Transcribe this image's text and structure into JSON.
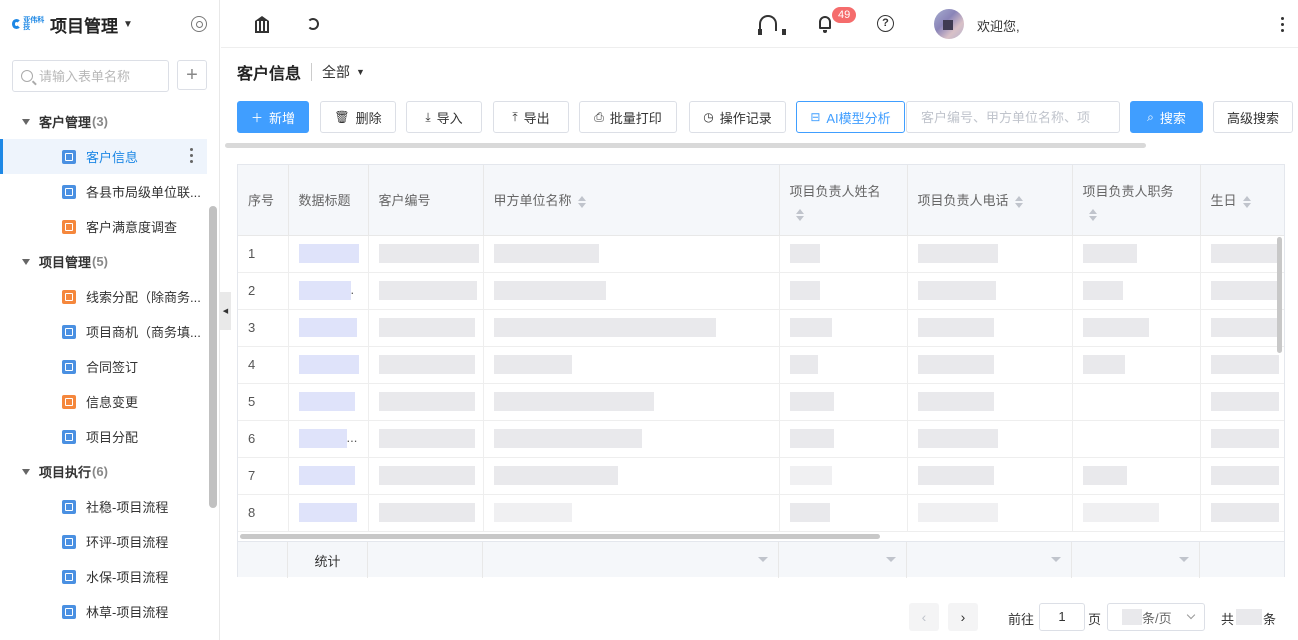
{
  "sidebar": {
    "logo_text": "亚伟科技",
    "title": "项目管理",
    "search_placeholder": "请输入表单名称",
    "add_label": "+",
    "groups": [
      {
        "label": "客户管理",
        "count": "(3)",
        "items": [
          {
            "label": "客户信息",
            "icon": "form-icon",
            "color": "#4a90e2",
            "active": true
          },
          {
            "label": "各县市局级单位联...",
            "icon": "form-icon",
            "color": "#4a90e2"
          },
          {
            "label": "客户满意度调查",
            "icon": "chart-icon",
            "color": "#f5873c"
          }
        ]
      },
      {
        "label": "项目管理",
        "count": "(5)",
        "items": [
          {
            "label": "线索分配（除商务...",
            "icon": "message-icon",
            "color": "#f5873c"
          },
          {
            "label": "项目商机（商务填...",
            "icon": "doc-icon",
            "color": "#4a90e2"
          },
          {
            "label": "合同签订",
            "icon": "doc-icon",
            "color": "#4a90e2"
          },
          {
            "label": "信息变更",
            "icon": "doc-icon",
            "color": "#f5873c"
          },
          {
            "label": "项目分配",
            "icon": "doc-icon",
            "color": "#4a90e2"
          }
        ]
      },
      {
        "label": "项目执行",
        "count": "(6)",
        "items": [
          {
            "label": "社稳-项目流程",
            "icon": "doc-icon",
            "color": "#4a90e2"
          },
          {
            "label": "环评-项目流程",
            "icon": "doc-icon",
            "color": "#4a90e2"
          },
          {
            "label": "水保-项目流程",
            "icon": "doc-icon",
            "color": "#4a90e2"
          },
          {
            "label": "林草-项目流程",
            "icon": "doc-icon",
            "color": "#4a90e2"
          }
        ]
      }
    ]
  },
  "topbar": {
    "notification_count": "49",
    "help_glyph": "?",
    "welcome": "欢迎您,"
  },
  "page": {
    "title": "客户信息",
    "filter": "全部"
  },
  "toolbar": {
    "new_label": "新增",
    "delete_label": "删除",
    "import_label": "导入",
    "export_label": "导出",
    "batch_print_label": "批量打印",
    "op_log_label": "操作记录",
    "ai_label": "AI模型分析",
    "search_placeholder": "客户编号、甲方单位名称、项",
    "search_label": "搜索",
    "advanced_label": "高级搜索"
  },
  "table": {
    "columns": {
      "seq": "序号",
      "data_title": "数据标题",
      "customer_no": "客户编号",
      "party_a": "甲方单位名称",
      "leader_name": "项目负责人姓名",
      "leader_phone": "项目负责人电话",
      "leader_title": "项目负责人职务",
      "birthday": "生日"
    },
    "rows": [
      {
        "seq": "1",
        "ellipsis": ""
      },
      {
        "seq": "2",
        "ellipsis": "."
      },
      {
        "seq": "3",
        "ellipsis": ""
      },
      {
        "seq": "4",
        "ellipsis": ""
      },
      {
        "seq": "5",
        "ellipsis": ""
      },
      {
        "seq": "6",
        "ellipsis": "..."
      },
      {
        "seq": "7",
        "ellipsis": ""
      },
      {
        "seq": "8",
        "ellipsis": ""
      }
    ],
    "summary_label": "统计"
  },
  "pagination": {
    "prev": "‹",
    "next": "›",
    "goto_label": "前往",
    "page_value": "1",
    "page_unit": "页",
    "page_size_suffix": "条/页",
    "total_prefix": "共",
    "total_suffix": "条"
  },
  "colors": {
    "accent": "#409eff",
    "badge": "#f56c6c",
    "icon_blue": "#4a90e2",
    "icon_orange": "#f5873c"
  }
}
